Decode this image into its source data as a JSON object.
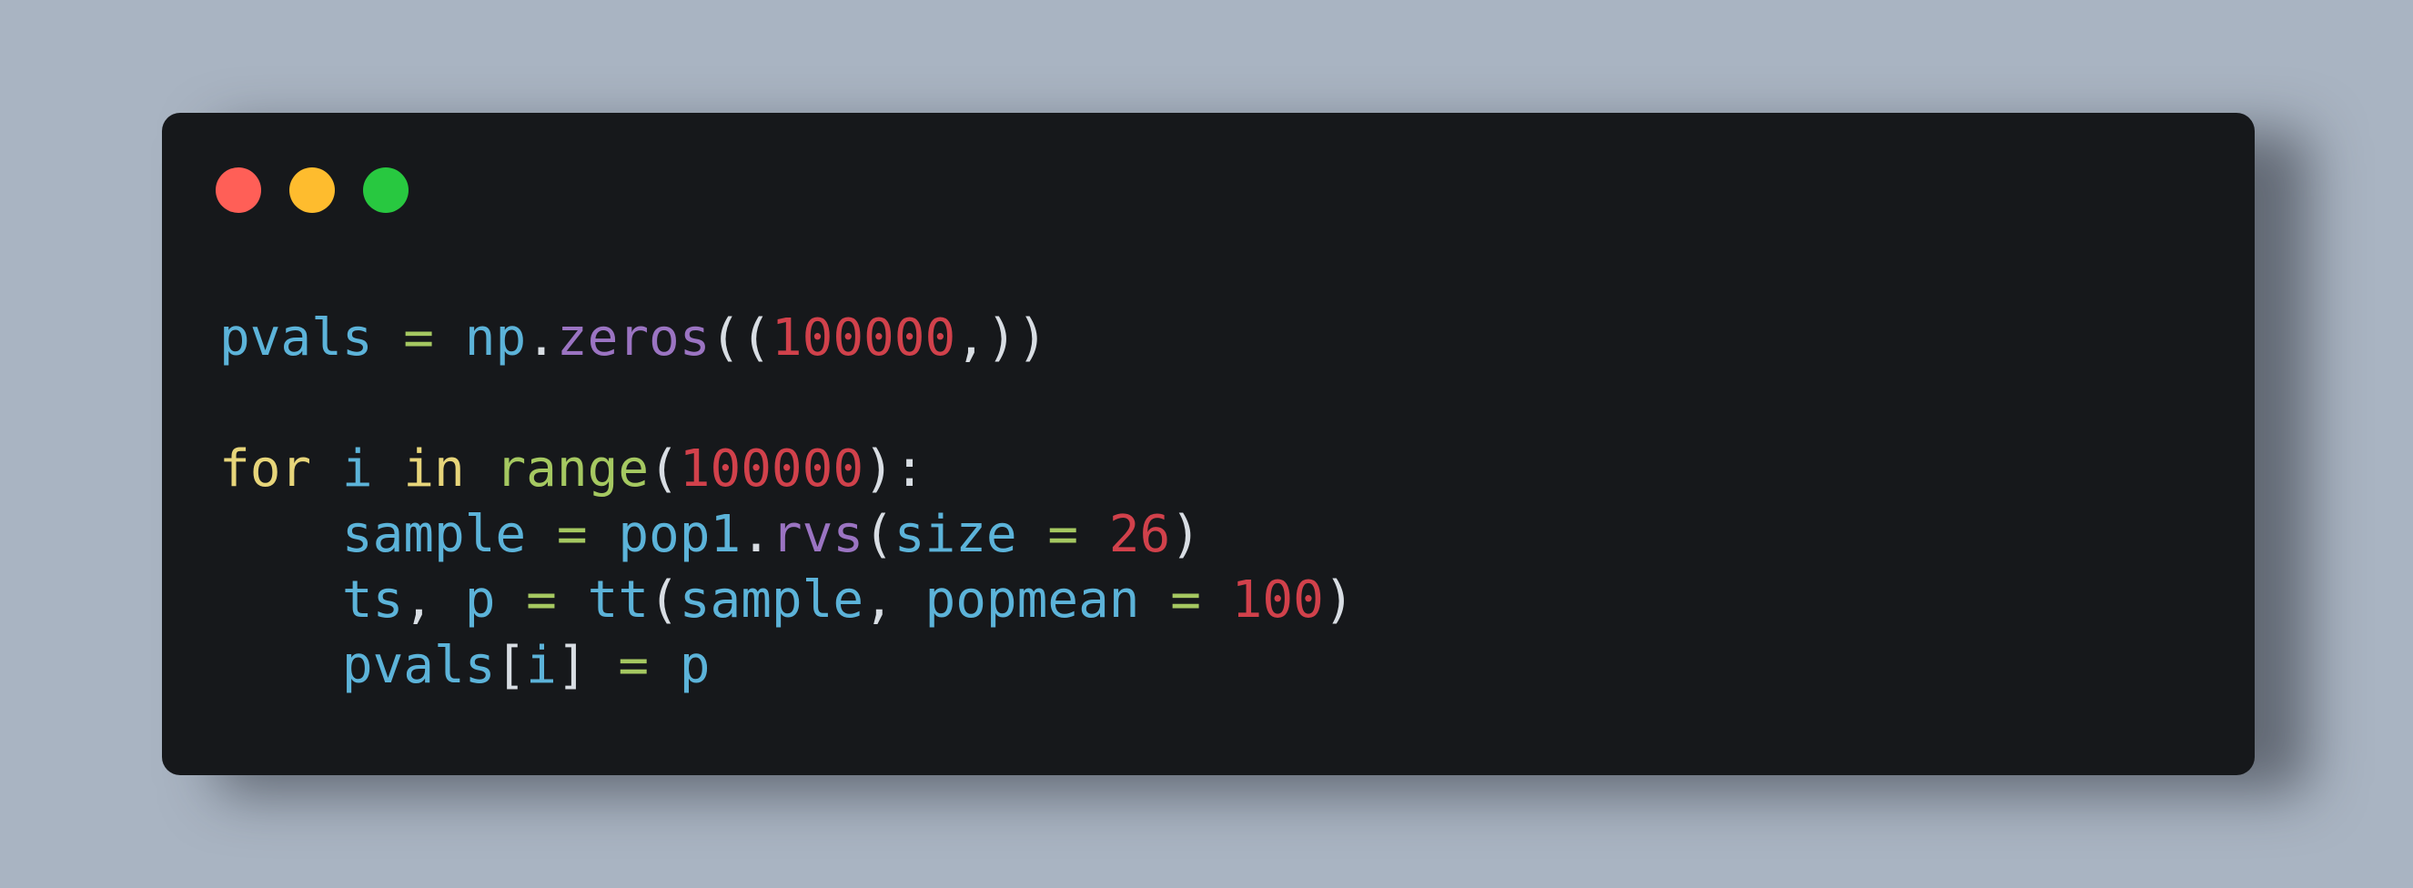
{
  "window": {
    "controls": {
      "close_color": "#ff5f57",
      "minimize_color": "#febc2e",
      "maximize_color": "#28c840"
    },
    "background_color": "#16181b",
    "page_background": "#a9b4c2"
  },
  "code": {
    "language": "python",
    "lines": [
      [
        {
          "t": "pvals",
          "k": "var"
        },
        {
          "t": " ",
          "k": "punc"
        },
        {
          "t": "=",
          "k": "op"
        },
        {
          "t": " ",
          "k": "punc"
        },
        {
          "t": "np",
          "k": "var"
        },
        {
          "t": ".",
          "k": "punc"
        },
        {
          "t": "zeros",
          "k": "fn"
        },
        {
          "t": "((",
          "k": "punc"
        },
        {
          "t": "100000",
          "k": "num"
        },
        {
          "t": ",))",
          "k": "punc"
        }
      ],
      [],
      [
        {
          "t": "for",
          "k": "kw"
        },
        {
          "t": " ",
          "k": "punc"
        },
        {
          "t": "i",
          "k": "var"
        },
        {
          "t": " ",
          "k": "punc"
        },
        {
          "t": "in",
          "k": "kw"
        },
        {
          "t": " ",
          "k": "punc"
        },
        {
          "t": "range",
          "k": "bi"
        },
        {
          "t": "(",
          "k": "punc"
        },
        {
          "t": "100000",
          "k": "num"
        },
        {
          "t": "):",
          "k": "punc"
        }
      ],
      [
        {
          "t": "    ",
          "k": "punc"
        },
        {
          "t": "sample",
          "k": "var"
        },
        {
          "t": " ",
          "k": "punc"
        },
        {
          "t": "=",
          "k": "op"
        },
        {
          "t": " ",
          "k": "punc"
        },
        {
          "t": "pop1",
          "k": "var"
        },
        {
          "t": ".",
          "k": "punc"
        },
        {
          "t": "rvs",
          "k": "fn"
        },
        {
          "t": "(",
          "k": "punc"
        },
        {
          "t": "size",
          "k": "var"
        },
        {
          "t": " ",
          "k": "punc"
        },
        {
          "t": "=",
          "k": "op"
        },
        {
          "t": " ",
          "k": "punc"
        },
        {
          "t": "26",
          "k": "num"
        },
        {
          "t": ")",
          "k": "punc"
        }
      ],
      [
        {
          "t": "    ",
          "k": "punc"
        },
        {
          "t": "ts",
          "k": "var"
        },
        {
          "t": ", ",
          "k": "punc"
        },
        {
          "t": "p",
          "k": "var"
        },
        {
          "t": " ",
          "k": "punc"
        },
        {
          "t": "=",
          "k": "op"
        },
        {
          "t": " ",
          "k": "punc"
        },
        {
          "t": "tt",
          "k": "var"
        },
        {
          "t": "(",
          "k": "punc"
        },
        {
          "t": "sample",
          "k": "var"
        },
        {
          "t": ", ",
          "k": "punc"
        },
        {
          "t": "popmean",
          "k": "var"
        },
        {
          "t": " ",
          "k": "punc"
        },
        {
          "t": "=",
          "k": "op"
        },
        {
          "t": " ",
          "k": "punc"
        },
        {
          "t": "100",
          "k": "num"
        },
        {
          "t": ")",
          "k": "punc"
        }
      ],
      [
        {
          "t": "    ",
          "k": "punc"
        },
        {
          "t": "pvals",
          "k": "var"
        },
        {
          "t": "[",
          "k": "punc"
        },
        {
          "t": "i",
          "k": "var"
        },
        {
          "t": "]",
          "k": "punc"
        },
        {
          "t": " ",
          "k": "punc"
        },
        {
          "t": "=",
          "k": "op"
        },
        {
          "t": " ",
          "k": "punc"
        },
        {
          "t": "p",
          "k": "var"
        }
      ]
    ]
  }
}
